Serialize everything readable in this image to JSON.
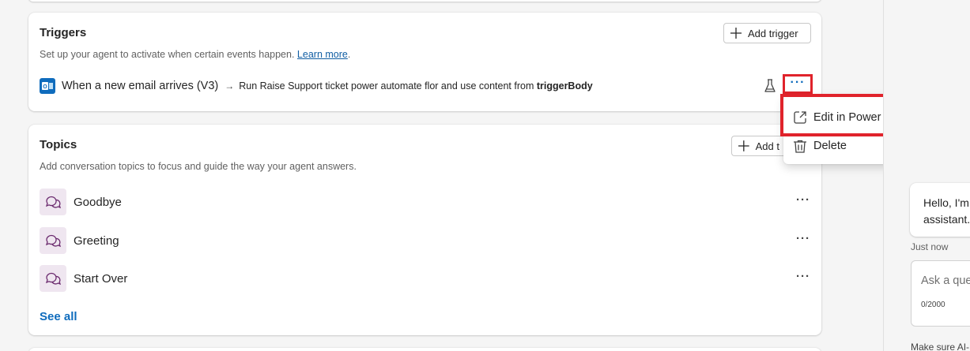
{
  "triggers": {
    "title": "Triggers",
    "description": "Set up your agent to activate when certain events happen.",
    "learn_more": "Learn more",
    "period": ".",
    "add_button": "Add trigger",
    "item": {
      "name": "When a new email arrives (V3)",
      "arrow": "→",
      "description_prefix": "Run Raise Support ticket power automate flor and use content from ",
      "description_bold": "triggerBody",
      "more": "···"
    }
  },
  "menu": {
    "edit_label": "Edit in Power Automate",
    "delete_label": "Delete"
  },
  "topics": {
    "title": "Topics",
    "description": "Add conversation topics to focus and guide the way your agent answers.",
    "add_button": "Add t",
    "items": [
      {
        "label": "Goodbye",
        "more": "···"
      },
      {
        "label": "Greeting",
        "more": "···"
      },
      {
        "label": "Start Over",
        "more": "···"
      }
    ],
    "see_all": "See all"
  },
  "side": {
    "bubble_line1": "Hello, I'm",
    "bubble_line2": "assistant.",
    "time": "Just now",
    "ask_placeholder": "Ask a que",
    "counter": "0/2000",
    "footer": "Make sure AI-"
  },
  "colors": {
    "accent": "#0f6cbd",
    "highlight": "#e0232b",
    "topic_icon_bg": "#efe6f0",
    "topic_icon": "#6b2a6e"
  },
  "icons": {
    "trigger": "outlook-icon",
    "test": "flask-icon",
    "edit": "open-external-icon",
    "delete": "trash-icon",
    "topic": "chat-bubbles-icon",
    "add": "plus-icon"
  }
}
